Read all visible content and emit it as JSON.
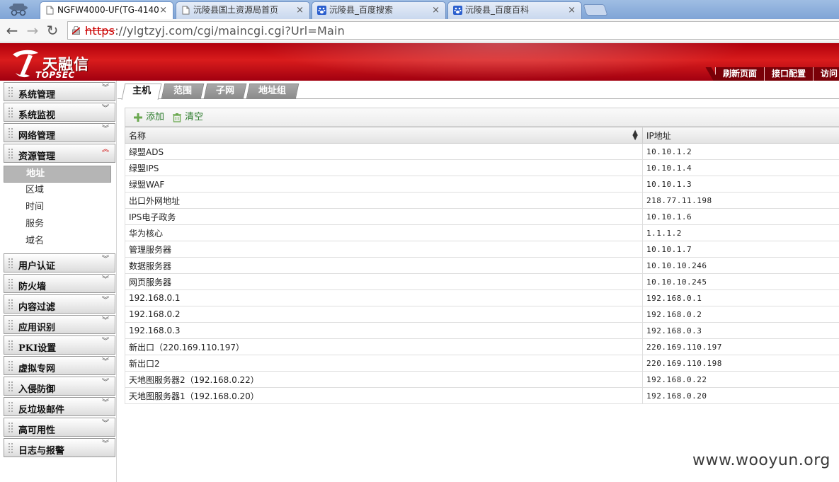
{
  "browser": {
    "tabs": [
      {
        "title": "NGFW4000-UF(TG-4140",
        "close": "×"
      },
      {
        "title": "沅陵县国土资源局首页",
        "close": "×"
      },
      {
        "title": "沅陵县_百度搜索",
        "close": "×"
      },
      {
        "title": "沅陵县_百度百科",
        "close": "×"
      }
    ],
    "nav": {
      "back": "←",
      "forward": "→",
      "reload": "↻"
    },
    "address": {
      "protocol": "https",
      "host": "://ylgtzyj.com",
      "path": "/cgi/maincgi.cgi?Url=Main"
    }
  },
  "header": {
    "logo_cn": "天融信",
    "logo_en": "TOPSEC",
    "links": [
      "刷新页面",
      "接口配置",
      "访问"
    ]
  },
  "menu": {
    "sections": [
      {
        "label": "系统管理"
      },
      {
        "label": "系统监视"
      },
      {
        "label": "网络管理"
      },
      {
        "label": "资源管理"
      },
      {
        "label": "用户认证"
      },
      {
        "label": "防火墙"
      },
      {
        "label": "内容过滤"
      },
      {
        "label": "应用识别"
      },
      {
        "label": "PKI设置"
      },
      {
        "label": "虚拟专网"
      },
      {
        "label": "入侵防御"
      },
      {
        "label": "反垃圾邮件"
      },
      {
        "label": "高可用性"
      },
      {
        "label": "日志与报警"
      }
    ],
    "open_items": [
      "地址",
      "区域",
      "时间",
      "服务",
      "域名"
    ],
    "chev_down": "︾",
    "chev_up": "︽"
  },
  "content": {
    "tabs": [
      "主机",
      "范围",
      "子网",
      "地址组"
    ],
    "toolbar": {
      "add": "添加",
      "clear": "清空"
    },
    "table": {
      "columns": [
        "名称",
        "IP地址"
      ],
      "sort_icon": "▲▼",
      "rows": [
        {
          "name": "绿盟ADS",
          "ip": "10.10.1.2"
        },
        {
          "name": "绿盟IPS",
          "ip": "10.10.1.4"
        },
        {
          "name": "绿盟WAF",
          "ip": "10.10.1.3"
        },
        {
          "name": "出口外网地址",
          "ip": "218.77.11.198"
        },
        {
          "name": "IPS电子政务",
          "ip": "10.10.1.6"
        },
        {
          "name": "华为核心",
          "ip": "1.1.1.2"
        },
        {
          "name": "管理服务器",
          "ip": "10.10.1.7"
        },
        {
          "name": "数据服务器",
          "ip": "10.10.10.246"
        },
        {
          "name": "网页服务器",
          "ip": "10.10.10.245"
        },
        {
          "name": "192.168.0.1",
          "ip": "192.168.0.1"
        },
        {
          "name": "192.168.0.2",
          "ip": "192.168.0.2"
        },
        {
          "name": "192.168.0.3",
          "ip": "192.168.0.3"
        },
        {
          "name": "新出口（220.169.110.197）",
          "ip": "220.169.110.197"
        },
        {
          "name": "新出口2",
          "ip": "220.169.110.198"
        },
        {
          "name": "天地图服务器2（192.168.0.22）",
          "ip": "192.168.0.22"
        },
        {
          "name": "天地图服务器1（192.168.0.20）",
          "ip": "192.168.0.20"
        }
      ]
    }
  },
  "watermark": "www.wooyun.org",
  "colors": {
    "header_red": "#c8101a",
    "add_green": "#2a7a2a",
    "proto_red": "#cc0000"
  }
}
